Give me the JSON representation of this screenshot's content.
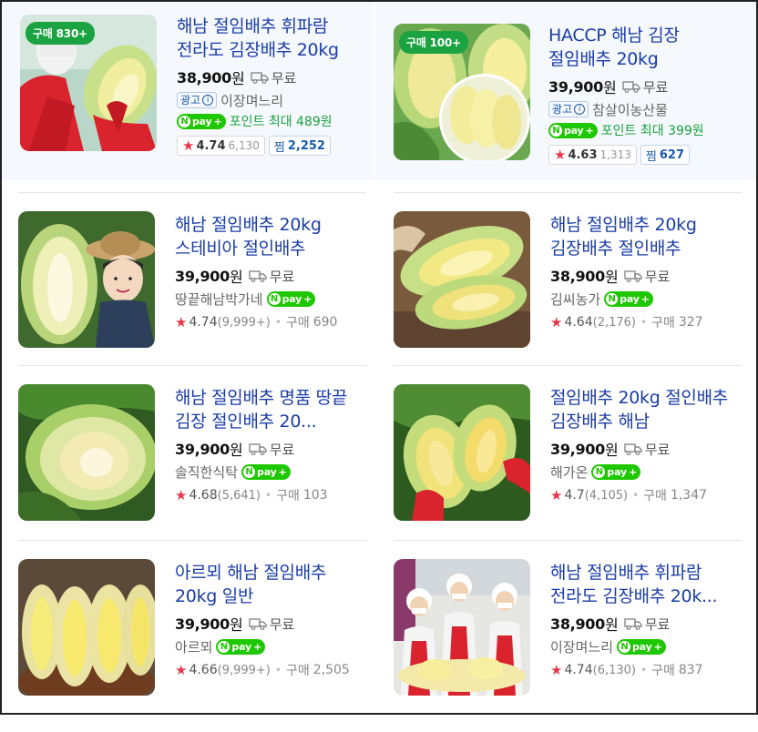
{
  "products": [
    {
      "title": "해남 절임배추 휘파람 전라도 김장배추 20kg",
      "badge": "구매 830+",
      "price": "38,900",
      "won": "원",
      "shipping": "무료",
      "ad_label": "광고",
      "seller": "이장며느리",
      "npay_points": "포인트 최대 489원",
      "rating": "4.74",
      "rating_count": "6,130",
      "zzim_label": "찜",
      "zzim_count": "2,252"
    },
    {
      "title": "HACCP 해남 김장 절임배추 20kg",
      "badge": "구매 100+",
      "price": "39,900",
      "won": "원",
      "shipping": "무료",
      "ad_label": "광고",
      "seller": "참살이농산물",
      "npay_points": "포인트 최대 399원",
      "rating": "4.63",
      "rating_count": "1,313",
      "zzim_label": "찜",
      "zzim_count": "627"
    },
    {
      "title": "해남 절임배추 20kg 스테비아 절인배추",
      "price": "39,900",
      "won": "원",
      "shipping": "무료",
      "seller": "땅끝해남박가네",
      "rating": "4.74",
      "rating_count": "(9,999+)",
      "buy_label": "구매",
      "buy_count": "690"
    },
    {
      "title": "해남 절임배추 20kg 김장배추 절인배추",
      "price": "38,900",
      "won": "원",
      "shipping": "무료",
      "seller": "김씨농가",
      "rating": "4.64",
      "rating_count": "(2,176)",
      "buy_label": "구매",
      "buy_count": "327"
    },
    {
      "title": "해남 절임배추 명품 땅끝 김장 절인배추 20...",
      "price": "39,900",
      "won": "원",
      "shipping": "무료",
      "seller": "솔직한식탁",
      "rating": "4.68",
      "rating_count": "(5,641)",
      "buy_label": "구매",
      "buy_count": "103"
    },
    {
      "title": "절임배추 20kg 절인배추 김장배추 해남",
      "price": "39,900",
      "won": "원",
      "shipping": "무료",
      "seller": "해가온",
      "rating": "4.7",
      "rating_count": "(4,105)",
      "buy_label": "구매",
      "buy_count": "1,347"
    },
    {
      "title": "아르뫼 해남 절임배추 20kg 일반",
      "price": "39,900",
      "won": "원",
      "shipping": "무료",
      "seller": "아르뫼",
      "rating": "4.66",
      "rating_count": "(9,999+)",
      "buy_label": "구매",
      "buy_count": "2,505"
    },
    {
      "title": "해남 절임배추 휘파람 전라도 김장배추 20k...",
      "price": "38,900",
      "won": "원",
      "shipping": "무료",
      "seller": "이장며느리",
      "rating": "4.74",
      "rating_count": "(6,130)",
      "buy_label": "구매",
      "buy_count": "837"
    }
  ],
  "npay": {
    "n": "N",
    "pay": "pay",
    "plus": "+"
  },
  "colors": {
    "title": "#1a3da6",
    "badge": "#1aa340",
    "star": "#e8374a",
    "npay": "#1ec800"
  }
}
